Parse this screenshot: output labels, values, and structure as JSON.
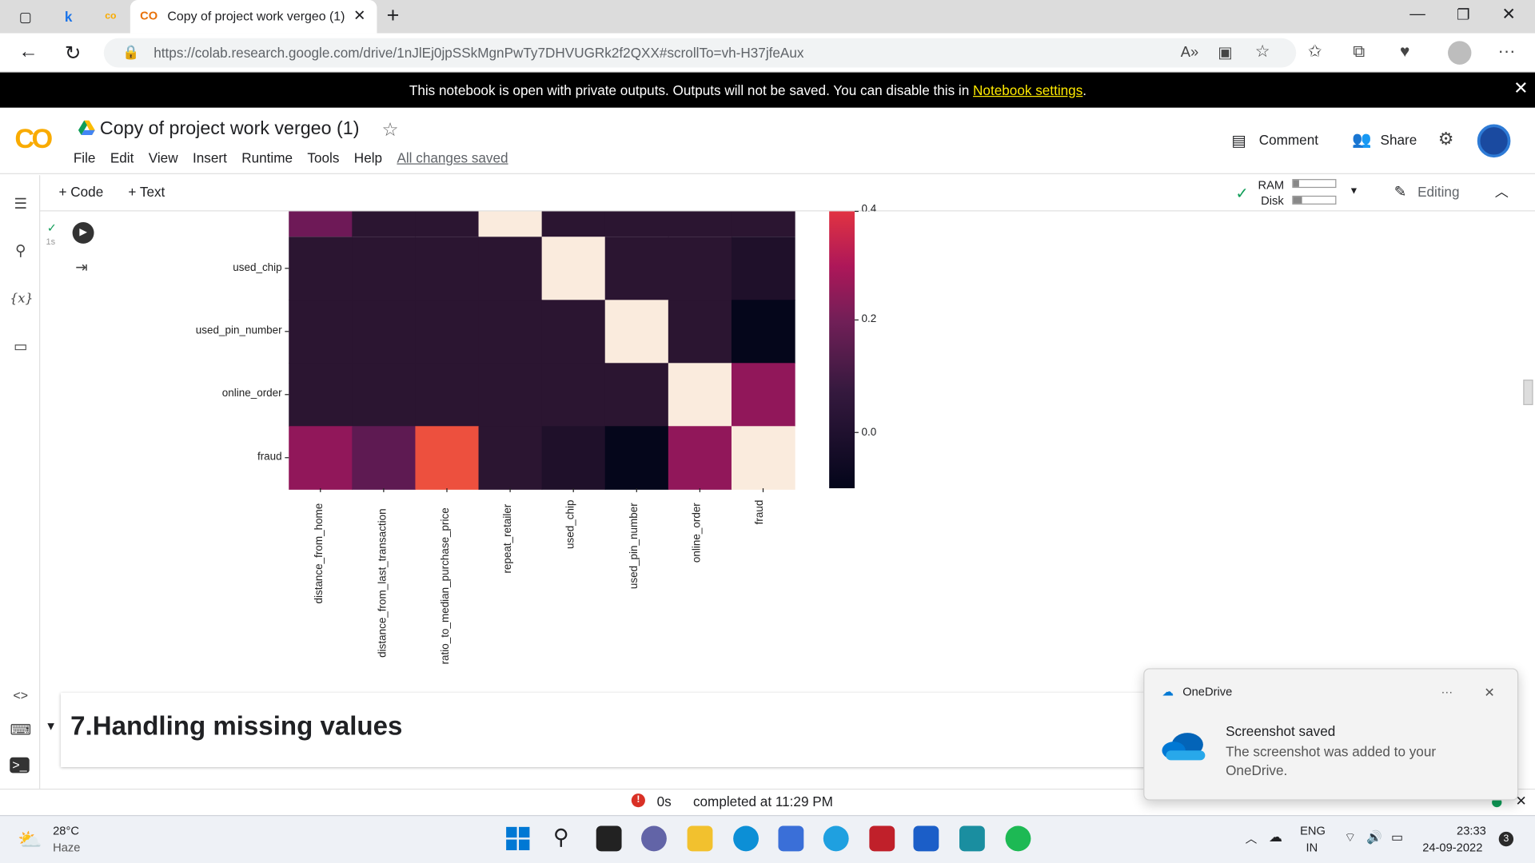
{
  "browser": {
    "tab_title": "Copy of project work vergeo (1)",
    "url": "https://colab.research.google.com/drive/1nJlEj0jpSSkMgnPwTy7DHVUGRk2f2QXX#scrollTo=vh-H37jfeAux",
    "pinned_tab_k": "k"
  },
  "banner": {
    "text": "This notebook is open with private outputs. Outputs will not be saved. You can disable this in ",
    "link": "Notebook settings",
    "end": "."
  },
  "colab": {
    "logo": "CO",
    "title": "Copy of project work vergeo (1)",
    "menu": [
      "File",
      "Edit",
      "View",
      "Insert",
      "Runtime",
      "Tools",
      "Help"
    ],
    "saved": "All changes saved",
    "comment": "Comment",
    "share": "Share",
    "add_code": "+ Code",
    "add_text": "+ Text",
    "ram": "RAM",
    "disk": "Disk",
    "editing": "Editing",
    "cell_time": "1s"
  },
  "chart_data": {
    "type": "heatmap",
    "rows": [
      "used_chip",
      "used_pin_number",
      "online_order",
      "fraud"
    ],
    "columns": [
      "distance_from_home",
      "distance_from_last_transaction",
      "ratio_to_median_purchase_price",
      "repeat_retailer",
      "used_chip",
      "used_pin_number",
      "online_order",
      "fraud"
    ],
    "partial_top_row": [
      0.12,
      0.0,
      0.0,
      1.0,
      0.0,
      0.0,
      0.0,
      0.0
    ],
    "values": [
      [
        0.0,
        0.0,
        0.0,
        0.0,
        1.0,
        0.0,
        0.0,
        -0.06
      ],
      [
        0.0,
        0.0,
        0.0,
        0.0,
        0.0,
        1.0,
        0.0,
        -0.19
      ],
      [
        0.0,
        0.0,
        0.0,
        0.0,
        0.0,
        0.0,
        1.0,
        0.19
      ],
      [
        0.19,
        0.09,
        0.46,
        0.0,
        -0.06,
        -0.19,
        0.19,
        1.0
      ]
    ],
    "colorbar_ticks": [
      "0.2",
      "0.0"
    ],
    "colorbar_partial_tick": "0.4",
    "colormap": "rocket"
  },
  "section": {
    "title": "7.Handling missing values"
  },
  "status": {
    "time": "0s",
    "completed": "completed at 11:29 PM"
  },
  "toast": {
    "app": "OneDrive",
    "title": "Screenshot saved",
    "body": "The screenshot was added to your OneDrive.",
    "more": "···"
  },
  "taskbar": {
    "temp": "28°C",
    "weather": "Haze",
    "lang1": "ENG",
    "lang2": "IN",
    "time": "23:33",
    "date": "24-09-2022",
    "badge": "3"
  }
}
